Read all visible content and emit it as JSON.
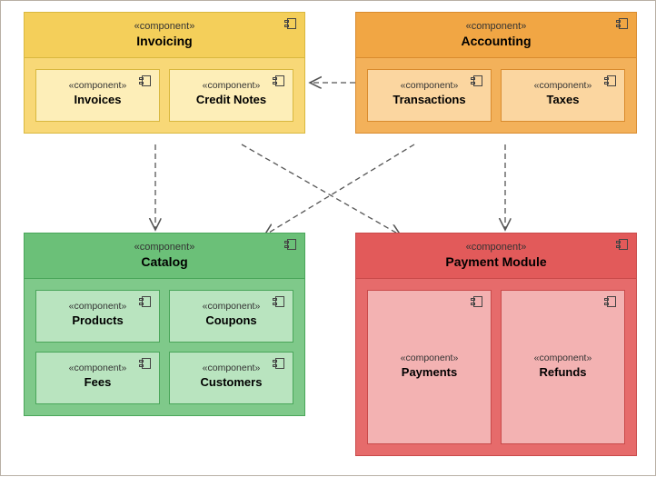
{
  "stereotype": "«component»",
  "components": {
    "invoicing": {
      "title": "Invoicing",
      "subs": [
        "Invoices",
        "Credit Notes"
      ]
    },
    "accounting": {
      "title": "Accounting",
      "subs": [
        "Transactions",
        "Taxes"
      ]
    },
    "catalog": {
      "title": "Catalog",
      "subs": [
        "Products",
        "Coupons",
        "Fees",
        "Customers"
      ]
    },
    "payment": {
      "title": "Payment Module",
      "subs": [
        "Payments",
        "Refunds"
      ]
    }
  },
  "dependencies": [
    {
      "from": "accounting",
      "to": "invoicing"
    },
    {
      "from": "invoicing",
      "to": "catalog"
    },
    {
      "from": "invoicing",
      "to": "payment"
    },
    {
      "from": "accounting",
      "to": "catalog"
    },
    {
      "from": "accounting",
      "to": "payment"
    }
  ]
}
